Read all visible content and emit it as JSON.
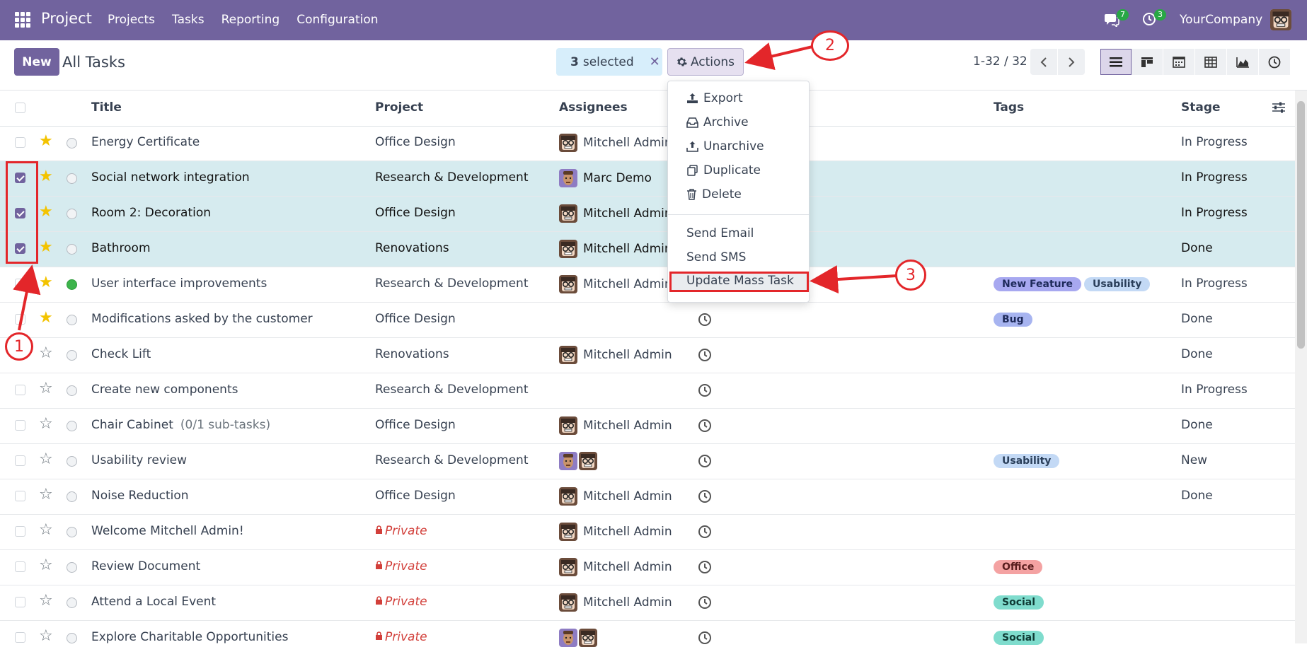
{
  "app": {
    "brand": "Project",
    "menu": [
      "Projects",
      "Tasks",
      "Reporting",
      "Configuration"
    ],
    "messages_count": "7",
    "activities_count": "3",
    "company": "YourCompany"
  },
  "control": {
    "new_label": "New",
    "title": "All Tasks",
    "selected_count": "3",
    "selected_label": "selected",
    "clear_icon": "✕",
    "actions_label": "Actions",
    "pager": "1-32 / 32"
  },
  "columns": {
    "title": "Title",
    "project": "Project",
    "assignees": "Assignees",
    "tags": "Tags",
    "stage": "Stage"
  },
  "rows": [
    {
      "title": "Energy Certificate",
      "project": "Office Design",
      "assignee": "Mitchell Admin",
      "stage": "In Progress"
    },
    {
      "title": "Social network integration",
      "project": "Research & Development",
      "assignee": "Marc Demo",
      "stage": "In Progress"
    },
    {
      "title": "Room 2: Decoration",
      "project": "Office Design",
      "assignee": "Mitchell Admin",
      "stage": "In Progress"
    },
    {
      "title": "Bathroom",
      "project": "Renovations",
      "assignee": "Mitchell Admin",
      "stage": "Done"
    },
    {
      "title": "User interface improvements",
      "project": "Research & Development",
      "assignee": "Mitchell Admin",
      "stage": "In Progress",
      "tags": [
        "New Feature",
        "Usability"
      ]
    },
    {
      "title": "Modifications asked by the customer",
      "project": "Office Design",
      "assignee": "",
      "stage": "Done",
      "tags": [
        "Bug"
      ]
    },
    {
      "title": "Check Lift",
      "project": "Renovations",
      "assignee": "Mitchell Admin",
      "stage": "Done"
    },
    {
      "title": "Create new components",
      "project": "Research & Development",
      "assignee": "",
      "stage": "In Progress"
    },
    {
      "title": "Chair Cabinet",
      "subtasks": "(0/1 sub-tasks)",
      "project": "Office Design",
      "assignee": "Mitchell Admin",
      "stage": "Done"
    },
    {
      "title": "Usability review",
      "project": "Research & Development",
      "assignee": "",
      "stage": "New",
      "tags": [
        "Usability"
      ]
    },
    {
      "title": "Noise Reduction",
      "project": "Office Design",
      "assignee": "Mitchell Admin",
      "stage": "Done"
    },
    {
      "title": "Welcome Mitchell Admin!",
      "project": "Private",
      "assignee": "Mitchell Admin",
      "stage": ""
    },
    {
      "title": "Review Document",
      "project": "Private",
      "assignee": "Mitchell Admin",
      "stage": "",
      "tags": [
        "Office"
      ]
    },
    {
      "title": "Attend a Local Event",
      "project": "Private",
      "assignee": "Mitchell Admin",
      "stage": "",
      "tags": [
        "Social"
      ]
    },
    {
      "title": "Explore Charitable Opportunities",
      "project": "Private",
      "assignee": "",
      "stage": "",
      "tags": [
        "Social"
      ]
    }
  ],
  "dropdown": {
    "export": "Export",
    "archive": "Archive",
    "unarchive": "Unarchive",
    "duplicate": "Duplicate",
    "delete": "Delete",
    "send_email": "Send Email",
    "send_sms": "Send SMS",
    "update_mass_task": "Update Mass Task"
  },
  "annotations": {
    "one": "1",
    "two": "2",
    "three": "3"
  },
  "colors": {
    "brand": "#71639e",
    "selected_row": "#d6ebef",
    "annotation": "#e3262a",
    "tag_new_feature": "#a7a8f0",
    "tag_usability": "#c3d9f5",
    "tag_bug": "#a7b4f0",
    "tag_office": "#f4a2a2",
    "tag_social": "#7fdccd"
  }
}
